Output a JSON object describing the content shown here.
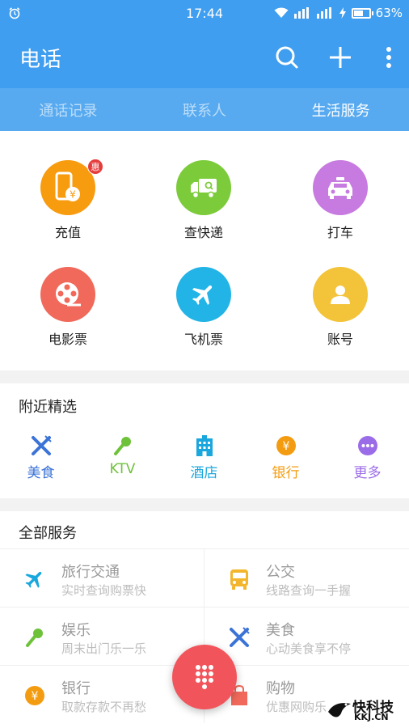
{
  "status_bar": {
    "time": "17:44",
    "battery": "63%",
    "battery_level": 0.63
  },
  "app_bar": {
    "title": "电话"
  },
  "tabs": [
    {
      "label": "通话记录",
      "active": false
    },
    {
      "label": "联系人",
      "active": false
    },
    {
      "label": "生活服务",
      "active": true
    }
  ],
  "quick_services": [
    {
      "label": "充值",
      "icon": "phone-topup-icon",
      "color": "#f79b0f",
      "badge": "惠"
    },
    {
      "label": "查快递",
      "icon": "delivery-truck-icon",
      "color": "#7ccb3a"
    },
    {
      "label": "打车",
      "icon": "taxi-icon",
      "color": "#c77ae0"
    },
    {
      "label": "电影票",
      "icon": "film-reel-icon",
      "color": "#f0695a"
    },
    {
      "label": "飞机票",
      "icon": "airplane-icon",
      "color": "#22b4e6"
    },
    {
      "label": "账号",
      "icon": "account-icon",
      "color": "#f3c33a"
    }
  ],
  "nearby": {
    "title": "附近精选",
    "items": [
      {
        "label": "美食",
        "icon": "food-icon",
        "color": "#3b73d6"
      },
      {
        "label": "KTV",
        "icon": "microphone-icon",
        "color": "#6ec23a"
      },
      {
        "label": "酒店",
        "icon": "hotel-icon",
        "color": "#1aa7dd"
      },
      {
        "label": "银行",
        "icon": "yuan-coin-icon",
        "color": "#f39c12"
      },
      {
        "label": "更多",
        "icon": "more-dots-icon",
        "color": "#9b6ce8"
      }
    ]
  },
  "all_services": {
    "title": "全部服务",
    "items": [
      {
        "name": "旅行交通",
        "desc": "实时查询购票快",
        "icon": "airplane-icon",
        "color": "#1aa7dd"
      },
      {
        "name": "公交",
        "desc": "线路查询一手握",
        "icon": "bus-icon",
        "color": "#f3b52b"
      },
      {
        "name": "娱乐",
        "desc": "周末出门乐一乐",
        "icon": "microphone-icon",
        "color": "#6ec23a"
      },
      {
        "name": "美食",
        "desc": "心动美食享不停",
        "icon": "food-icon",
        "color": "#3b73d6"
      },
      {
        "name": "银行",
        "desc": "取款存款不再愁",
        "icon": "yuan-coin-icon",
        "color": "#f39c12"
      },
      {
        "name": "购物",
        "desc": "优惠网购乐",
        "icon": "shopping-bag-icon",
        "color": "#f0695a"
      }
    ]
  },
  "watermark": {
    "cn": "快科技",
    "en": "KKJ.CN"
  }
}
